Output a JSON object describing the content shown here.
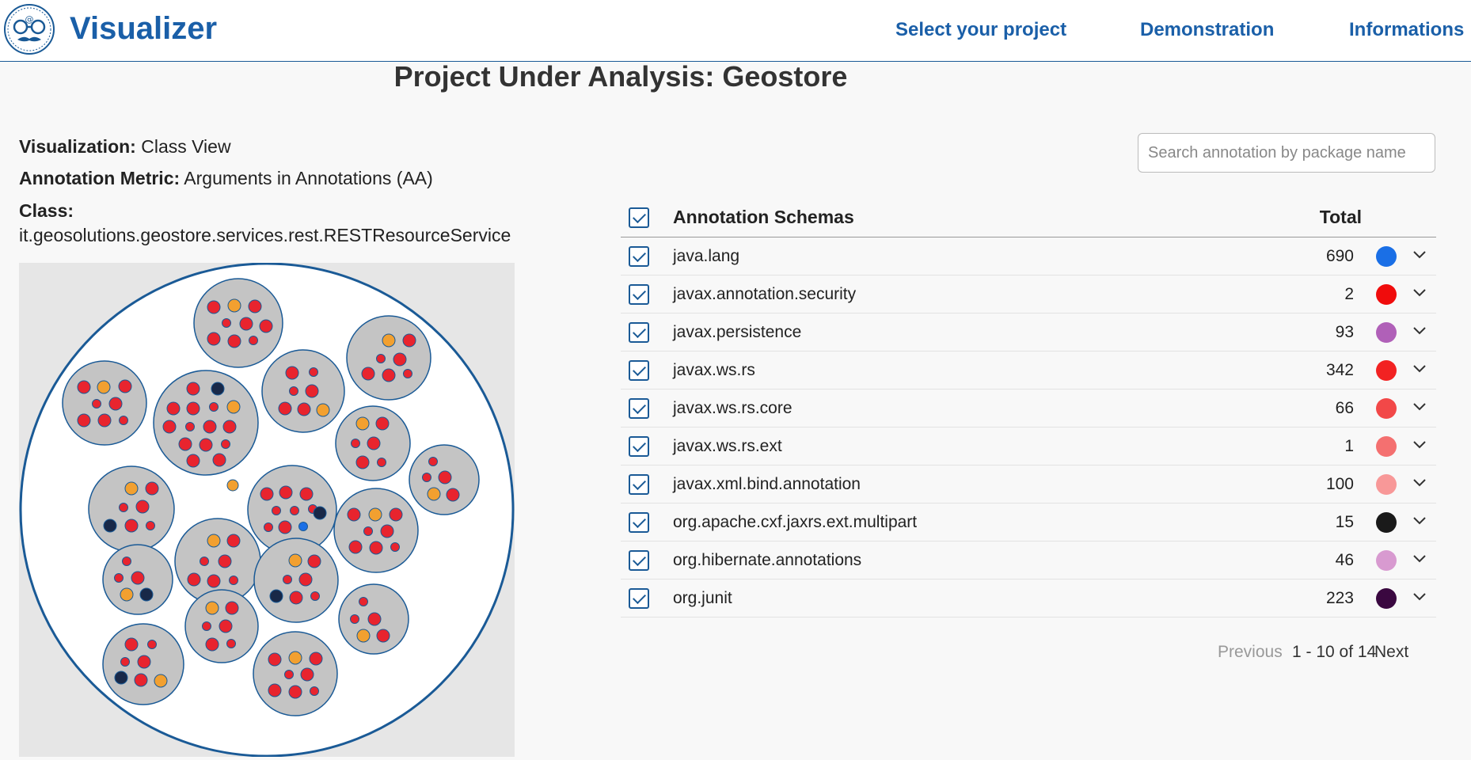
{
  "header": {
    "brand": "Visualizer",
    "nav": [
      "Select your project",
      "Demonstration",
      "Informations"
    ]
  },
  "title": "Project Under Analysis: Geostore",
  "meta": {
    "visualization_label": "Visualization:",
    "visualization_value": "Class View",
    "metric_label": "Annotation Metric:",
    "metric_value": "Arguments in Annotations (AA)",
    "class_label": "Class:",
    "class_value": "it.geosolutions.geostore.services.rest.RESTResourceService"
  },
  "search": {
    "placeholder": "Search annotation by package name"
  },
  "table": {
    "header_name": "Annotation Schemas",
    "header_total": "Total",
    "rows": [
      {
        "name": "java.lang",
        "total": "690",
        "color": "#1a6fe6"
      },
      {
        "name": "javax.annotation.security",
        "total": "2",
        "color": "#f00c0c"
      },
      {
        "name": "javax.persistence",
        "total": "93",
        "color": "#b060b8"
      },
      {
        "name": "javax.ws.rs",
        "total": "342",
        "color": "#f22222"
      },
      {
        "name": "javax.ws.rs.core",
        "total": "66",
        "color": "#f24848"
      },
      {
        "name": "javax.ws.rs.ext",
        "total": "1",
        "color": "#f47070"
      },
      {
        "name": "javax.xml.bind.annotation",
        "total": "100",
        "color": "#f89898"
      },
      {
        "name": "org.apache.cxf.jaxrs.ext.multipart",
        "total": "15",
        "color": "#1a1a1a"
      },
      {
        "name": "org.hibernate.annotations",
        "total": "46",
        "color": "#d89ad0"
      },
      {
        "name": "org.junit",
        "total": "223",
        "color": "#3a0840"
      }
    ]
  },
  "pagination": {
    "prev": "Previous",
    "range": "1 - 10 of 14",
    "next": "Next"
  },
  "viz_colors": {
    "red": "#e8242e",
    "orange": "#f2a030",
    "navy": "#182848",
    "blue": "#1a6fe6",
    "bubble": "#c4c4c4",
    "stroke": "#1a5a96"
  }
}
